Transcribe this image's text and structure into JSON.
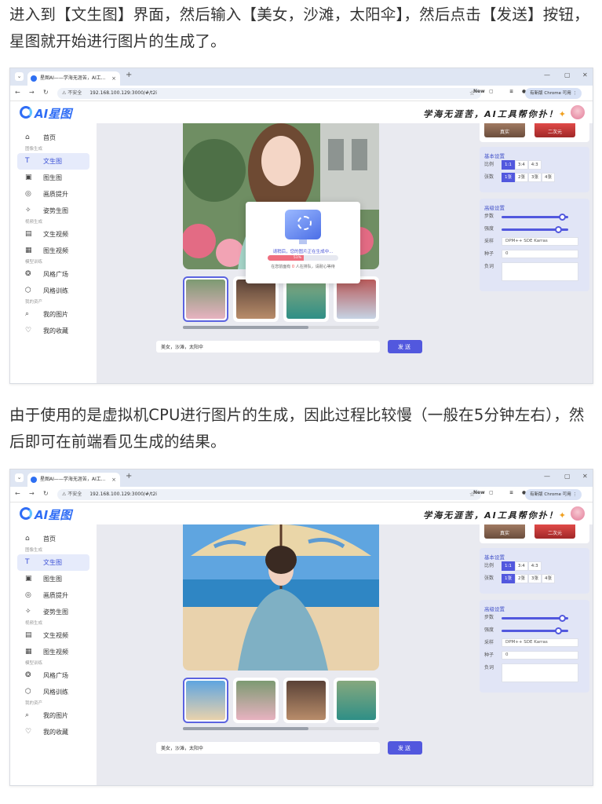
{
  "article": {
    "para1": "进入到【文生图】界面，然后输入【美女，沙滩，太阳伞】，然后点击【发送】按钮，星图就开始进行图片的生成了。",
    "para2": "由于使用的是虚拟机CPU进行图片的生成，因此过程比较慢（一般在5分钟左右），然后即可在前端看见生成的结果。"
  },
  "browser": {
    "tab_title": "星图AI——学海无涯苦，AI工...",
    "tab_close": "×",
    "new_tab": "+",
    "insecure_label": "⚠ 不安全",
    "url": "192.168.100.129:3000/#/t2i",
    "new_badge": "New",
    "chrome_pill": "有新版 Chrome 可用 ⋮",
    "min": "—",
    "max": "▢",
    "close": "✕"
  },
  "app": {
    "logo": "AI星图",
    "slogan": "学海无涯苦，AI工具帮你扑！",
    "sidebar": [
      {
        "type": "item",
        "label": "首页",
        "icon": "⌂"
      },
      {
        "type": "group",
        "label": "图像生成"
      },
      {
        "type": "item",
        "label": "文生图",
        "icon": "T",
        "active": true
      },
      {
        "type": "item",
        "label": "图生图",
        "icon": "▣"
      },
      {
        "type": "item",
        "label": "画质提升",
        "icon": "◎"
      },
      {
        "type": "item",
        "label": "姿势生图",
        "icon": "✧"
      },
      {
        "type": "group",
        "label": "视频生成"
      },
      {
        "type": "item",
        "label": "文生视频",
        "icon": "▤"
      },
      {
        "type": "item",
        "label": "图生视频",
        "icon": "▦"
      },
      {
        "type": "group",
        "label": "模型训练"
      },
      {
        "type": "item",
        "label": "风格广场",
        "icon": "❂"
      },
      {
        "type": "item",
        "label": "风格训练",
        "icon": "⬡"
      },
      {
        "type": "group",
        "label": "我的资产"
      },
      {
        "type": "item",
        "label": "我的图片",
        "icon": "⌕"
      },
      {
        "type": "item",
        "label": "我的收藏",
        "icon": "♡"
      }
    ],
    "prompt": "美女，沙滩，太阳伞",
    "send": "发送",
    "styles": [
      "真实",
      "二次元"
    ],
    "basic_title": "基本设置",
    "ratio_label": "比例",
    "ratios": [
      "1:1",
      "3:4",
      "4:3"
    ],
    "count_label": "张数",
    "counts": [
      "1张",
      "2张",
      "3张",
      "4张"
    ],
    "advanced_title": "高级设置",
    "steps_label": "步数",
    "steps_level": 0.9,
    "strength_label": "强度",
    "strength_level": 0.85,
    "sampler_label": "采样",
    "sampler": "DPM++ SDE Karras",
    "seed_label": "种子",
    "seed": "0",
    "negative_label": "负词"
  },
  "overlay": {
    "message": "请稍后，您的图片正在生成中...",
    "percent_text": "51%",
    "progress": 0.51,
    "queue_prefix": "在您前面有",
    "queue_count": "0",
    "queue_suffix": "人在排队，请耐心等待"
  }
}
